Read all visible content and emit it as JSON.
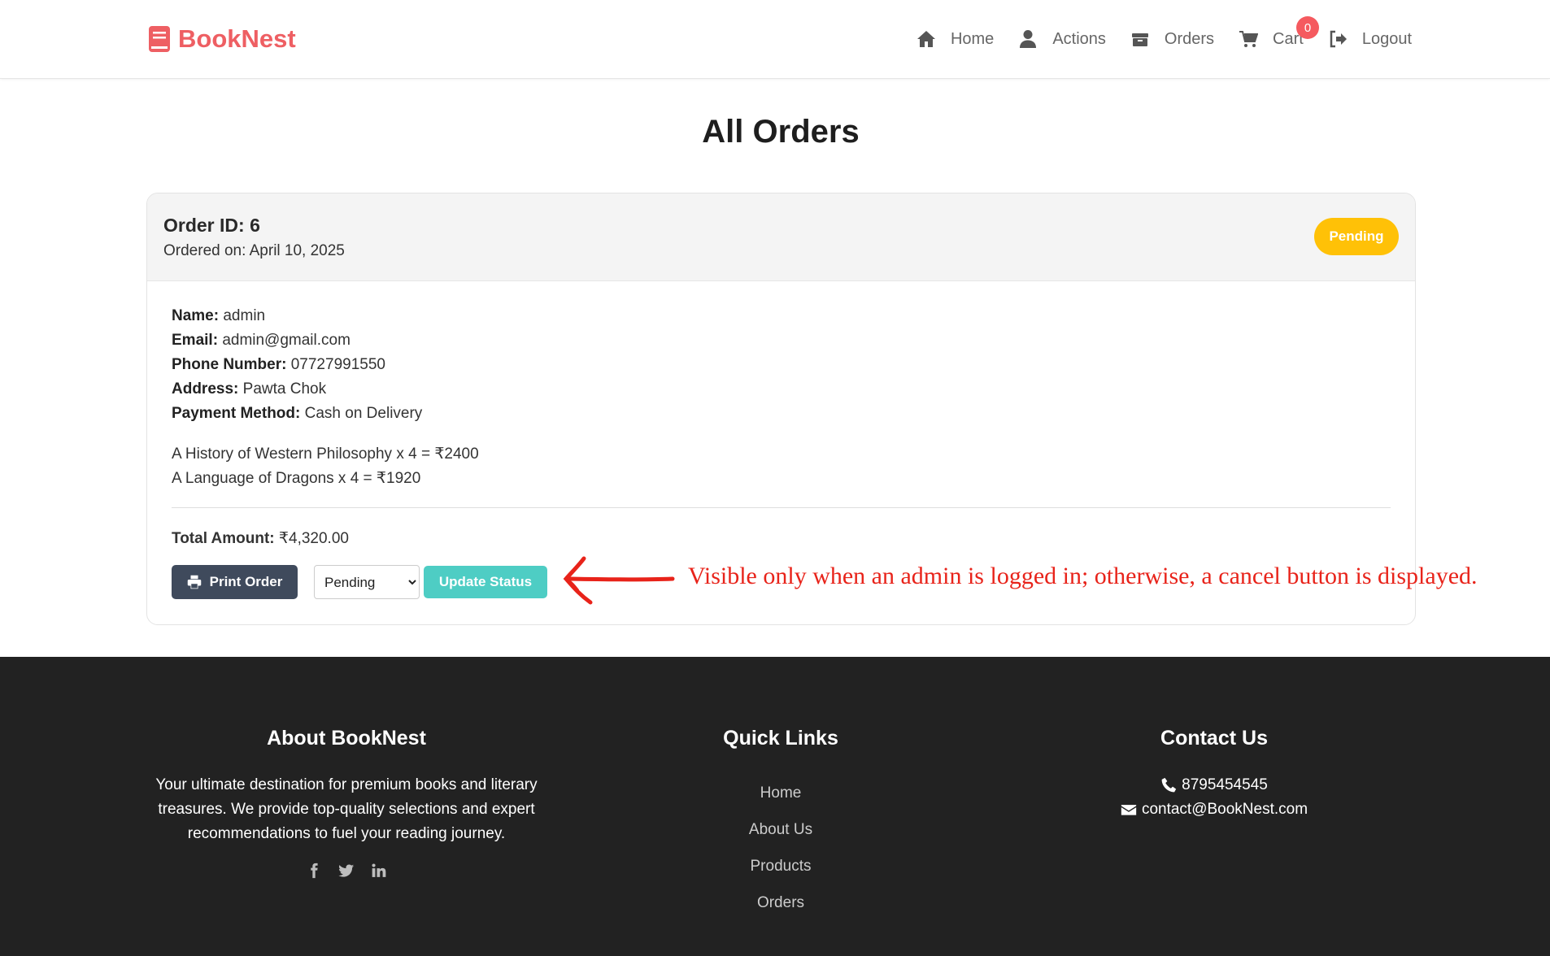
{
  "navbar": {
    "brand": "BookNest",
    "links": {
      "home": "Home",
      "actions": "Actions",
      "orders": "Orders",
      "cart": "Cart",
      "logout": "Logout"
    },
    "cart_count": "0"
  },
  "page_title": "All Orders",
  "order": {
    "id_label": "Order ID: 6",
    "date_label": "Ordered on: April 10, 2025",
    "status": "Pending",
    "details": {
      "name_label": "Name:",
      "name": "admin",
      "email_label": "Email:",
      "email": "admin@gmail.com",
      "phone_label": "Phone Number:",
      "phone": "07727991550",
      "address_label": "Address:",
      "address": "Pawta Chok",
      "payment_label": "Payment Method:",
      "payment": "Cash on Delivery"
    },
    "items": [
      "A History of Western Philosophy x 4 = ₹2400",
      "A Language of Dragons x 4 = ₹1920"
    ],
    "total_label": "Total Amount:",
    "total": "₹4,320.00",
    "print_label": "Print Order",
    "status_select": {
      "selected": "Pending"
    },
    "update_label": "Update Status"
  },
  "annotation": "Visible only when an admin is logged in; otherwise, a cancel button is displayed.",
  "footer": {
    "about": {
      "title": "About BookNest",
      "text": "Your ultimate destination for premium books and literary treasures. We provide top-quality selections and expert recommendations to fuel your reading journey."
    },
    "quick_links": {
      "title": "Quick Links",
      "items": [
        "Home",
        "About Us",
        "Products",
        "Orders"
      ]
    },
    "contact": {
      "title": "Contact Us",
      "phone": "8795454545",
      "email": "contact@BookNest.com"
    }
  },
  "colors": {
    "brand": "#ee5f63",
    "status_pending": "#ffc107",
    "update_button": "#4ecdc4",
    "print_button": "#3f4a5c",
    "footer_bg": "#222222",
    "annotation": "#e8231a"
  }
}
